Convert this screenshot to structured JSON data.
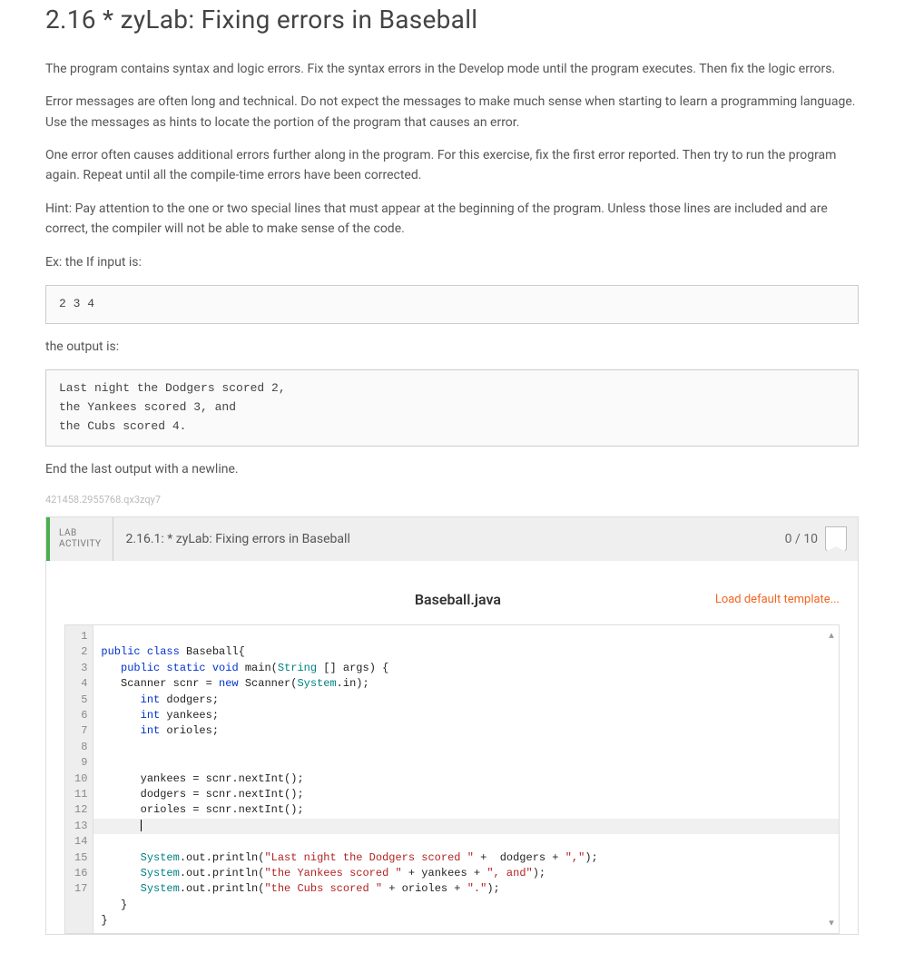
{
  "heading": "2.16 * zyLab: Fixing errors in Baseball",
  "paragraphs": {
    "p1": "The program contains syntax and logic errors. Fix the syntax errors in the Develop mode until the program executes. Then fix the logic errors.",
    "p2": "Error messages are often long and technical. Do not expect the messages to make much sense when starting to learn a programming language. Use the messages as hints to locate the portion of the program that causes an error.",
    "p3": "One error often causes additional errors further along in the program. For this exercise, fix the first error reported. Then try to run the program again. Repeat until all the compile-time errors have been corrected.",
    "p4": "Hint: Pay attention to the one or two special lines that must appear at the beginning of the program. Unless those lines are included and are correct, the compiler will not be able to make sense of the code.",
    "p5": "Ex: the If input is:",
    "p6": "the output is:",
    "p7": "End the last output with a newline."
  },
  "input_example": "2 3 4",
  "output_example": "Last night the Dodgers scored 2,\nthe Yankees scored 3, and\nthe Cubs scored 4.",
  "random_id": "421458.2955768.qx3zqy7",
  "lab": {
    "label_line1": "LAB",
    "label_line2": "ACTIVITY",
    "title": "2.16.1: * zyLab: Fixing errors in Baseball",
    "score": "0 / 10",
    "filename": "Baseball.java",
    "load_template": "Load default template..."
  },
  "code": {
    "line_numbers": " 1\n 2\n 3\n 4\n 5\n 6\n 7\n 8\n 9\n10\n11\n12\n13\n14\n15\n16\n17",
    "l1_a": "public",
    "l1_b": " class",
    "l1_c": " Baseball{",
    "l2_a": "   public",
    "l2_b": " static",
    "l2_c": " void",
    "l2_d": " main(",
    "l2_e": "String",
    "l2_f": " [] args) {",
    "l3_a": "   Scanner scnr = ",
    "l3_b": "new",
    "l3_c": " Scanner(",
    "l3_d": "System",
    "l3_e": ".in);",
    "l4": "      int",
    "l4b": " dodgers;",
    "l5": "      int",
    "l5b": " yankees;",
    "l6": "      int",
    "l6b": " orioles;",
    "l7": "",
    "l8": "",
    "l9": "      yankees = scnr.nextInt();",
    "l10": "      dodgers = scnr.nextInt();",
    "l11": "      orioles = scnr.nextInt();",
    "l12": "      ",
    "l13_a": "      System",
    "l13_b": ".out.println(",
    "l13_c": "\"Last night the Dodgers scored \"",
    "l13_d": " +  dodgers + ",
    "l13_e": "\",\"",
    "l13_f": ");",
    "l14_a": "      System",
    "l14_b": ".out.println(",
    "l14_c": "\"the Yankees scored \"",
    "l14_d": " + yankees + ",
    "l14_e": "\", and\"",
    "l14_f": ");",
    "l15_a": "      System",
    "l15_b": ".out.println(",
    "l15_c": "\"the Cubs scored \"",
    "l15_d": " + orioles + ",
    "l15_e": "\".\"",
    "l15_f": ");",
    "l16": "   }",
    "l17": "}"
  }
}
